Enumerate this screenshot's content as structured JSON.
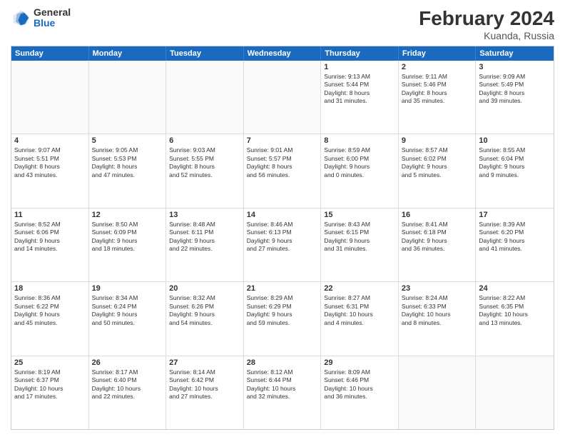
{
  "header": {
    "logo_general": "General",
    "logo_blue": "Blue",
    "title": "February 2024",
    "subtitle": "Kuanda, Russia"
  },
  "days": [
    "Sunday",
    "Monday",
    "Tuesday",
    "Wednesday",
    "Thursday",
    "Friday",
    "Saturday"
  ],
  "rows": [
    [
      {
        "day": "",
        "lines": []
      },
      {
        "day": "",
        "lines": []
      },
      {
        "day": "",
        "lines": []
      },
      {
        "day": "",
        "lines": []
      },
      {
        "day": "1",
        "lines": [
          "Sunrise: 9:13 AM",
          "Sunset: 5:44 PM",
          "Daylight: 8 hours",
          "and 31 minutes."
        ]
      },
      {
        "day": "2",
        "lines": [
          "Sunrise: 9:11 AM",
          "Sunset: 5:46 PM",
          "Daylight: 8 hours",
          "and 35 minutes."
        ]
      },
      {
        "day": "3",
        "lines": [
          "Sunrise: 9:09 AM",
          "Sunset: 5:49 PM",
          "Daylight: 8 hours",
          "and 39 minutes."
        ]
      }
    ],
    [
      {
        "day": "4",
        "lines": [
          "Sunrise: 9:07 AM",
          "Sunset: 5:51 PM",
          "Daylight: 8 hours",
          "and 43 minutes."
        ]
      },
      {
        "day": "5",
        "lines": [
          "Sunrise: 9:05 AM",
          "Sunset: 5:53 PM",
          "Daylight: 8 hours",
          "and 47 minutes."
        ]
      },
      {
        "day": "6",
        "lines": [
          "Sunrise: 9:03 AM",
          "Sunset: 5:55 PM",
          "Daylight: 8 hours",
          "and 52 minutes."
        ]
      },
      {
        "day": "7",
        "lines": [
          "Sunrise: 9:01 AM",
          "Sunset: 5:57 PM",
          "Daylight: 8 hours",
          "and 56 minutes."
        ]
      },
      {
        "day": "8",
        "lines": [
          "Sunrise: 8:59 AM",
          "Sunset: 6:00 PM",
          "Daylight: 9 hours",
          "and 0 minutes."
        ]
      },
      {
        "day": "9",
        "lines": [
          "Sunrise: 8:57 AM",
          "Sunset: 6:02 PM",
          "Daylight: 9 hours",
          "and 5 minutes."
        ]
      },
      {
        "day": "10",
        "lines": [
          "Sunrise: 8:55 AM",
          "Sunset: 6:04 PM",
          "Daylight: 9 hours",
          "and 9 minutes."
        ]
      }
    ],
    [
      {
        "day": "11",
        "lines": [
          "Sunrise: 8:52 AM",
          "Sunset: 6:06 PM",
          "Daylight: 9 hours",
          "and 14 minutes."
        ]
      },
      {
        "day": "12",
        "lines": [
          "Sunrise: 8:50 AM",
          "Sunset: 6:09 PM",
          "Daylight: 9 hours",
          "and 18 minutes."
        ]
      },
      {
        "day": "13",
        "lines": [
          "Sunrise: 8:48 AM",
          "Sunset: 6:11 PM",
          "Daylight: 9 hours",
          "and 22 minutes."
        ]
      },
      {
        "day": "14",
        "lines": [
          "Sunrise: 8:46 AM",
          "Sunset: 6:13 PM",
          "Daylight: 9 hours",
          "and 27 minutes."
        ]
      },
      {
        "day": "15",
        "lines": [
          "Sunrise: 8:43 AM",
          "Sunset: 6:15 PM",
          "Daylight: 9 hours",
          "and 31 minutes."
        ]
      },
      {
        "day": "16",
        "lines": [
          "Sunrise: 8:41 AM",
          "Sunset: 6:18 PM",
          "Daylight: 9 hours",
          "and 36 minutes."
        ]
      },
      {
        "day": "17",
        "lines": [
          "Sunrise: 8:39 AM",
          "Sunset: 6:20 PM",
          "Daylight: 9 hours",
          "and 41 minutes."
        ]
      }
    ],
    [
      {
        "day": "18",
        "lines": [
          "Sunrise: 8:36 AM",
          "Sunset: 6:22 PM",
          "Daylight: 9 hours",
          "and 45 minutes."
        ]
      },
      {
        "day": "19",
        "lines": [
          "Sunrise: 8:34 AM",
          "Sunset: 6:24 PM",
          "Daylight: 9 hours",
          "and 50 minutes."
        ]
      },
      {
        "day": "20",
        "lines": [
          "Sunrise: 8:32 AM",
          "Sunset: 6:26 PM",
          "Daylight: 9 hours",
          "and 54 minutes."
        ]
      },
      {
        "day": "21",
        "lines": [
          "Sunrise: 8:29 AM",
          "Sunset: 6:29 PM",
          "Daylight: 9 hours",
          "and 59 minutes."
        ]
      },
      {
        "day": "22",
        "lines": [
          "Sunrise: 8:27 AM",
          "Sunset: 6:31 PM",
          "Daylight: 10 hours",
          "and 4 minutes."
        ]
      },
      {
        "day": "23",
        "lines": [
          "Sunrise: 8:24 AM",
          "Sunset: 6:33 PM",
          "Daylight: 10 hours",
          "and 8 minutes."
        ]
      },
      {
        "day": "24",
        "lines": [
          "Sunrise: 8:22 AM",
          "Sunset: 6:35 PM",
          "Daylight: 10 hours",
          "and 13 minutes."
        ]
      }
    ],
    [
      {
        "day": "25",
        "lines": [
          "Sunrise: 8:19 AM",
          "Sunset: 6:37 PM",
          "Daylight: 10 hours",
          "and 17 minutes."
        ]
      },
      {
        "day": "26",
        "lines": [
          "Sunrise: 8:17 AM",
          "Sunset: 6:40 PM",
          "Daylight: 10 hours",
          "and 22 minutes."
        ]
      },
      {
        "day": "27",
        "lines": [
          "Sunrise: 8:14 AM",
          "Sunset: 6:42 PM",
          "Daylight: 10 hours",
          "and 27 minutes."
        ]
      },
      {
        "day": "28",
        "lines": [
          "Sunrise: 8:12 AM",
          "Sunset: 6:44 PM",
          "Daylight: 10 hours",
          "and 32 minutes."
        ]
      },
      {
        "day": "29",
        "lines": [
          "Sunrise: 8:09 AM",
          "Sunset: 6:46 PM",
          "Daylight: 10 hours",
          "and 36 minutes."
        ]
      },
      {
        "day": "",
        "lines": []
      },
      {
        "day": "",
        "lines": []
      }
    ]
  ]
}
